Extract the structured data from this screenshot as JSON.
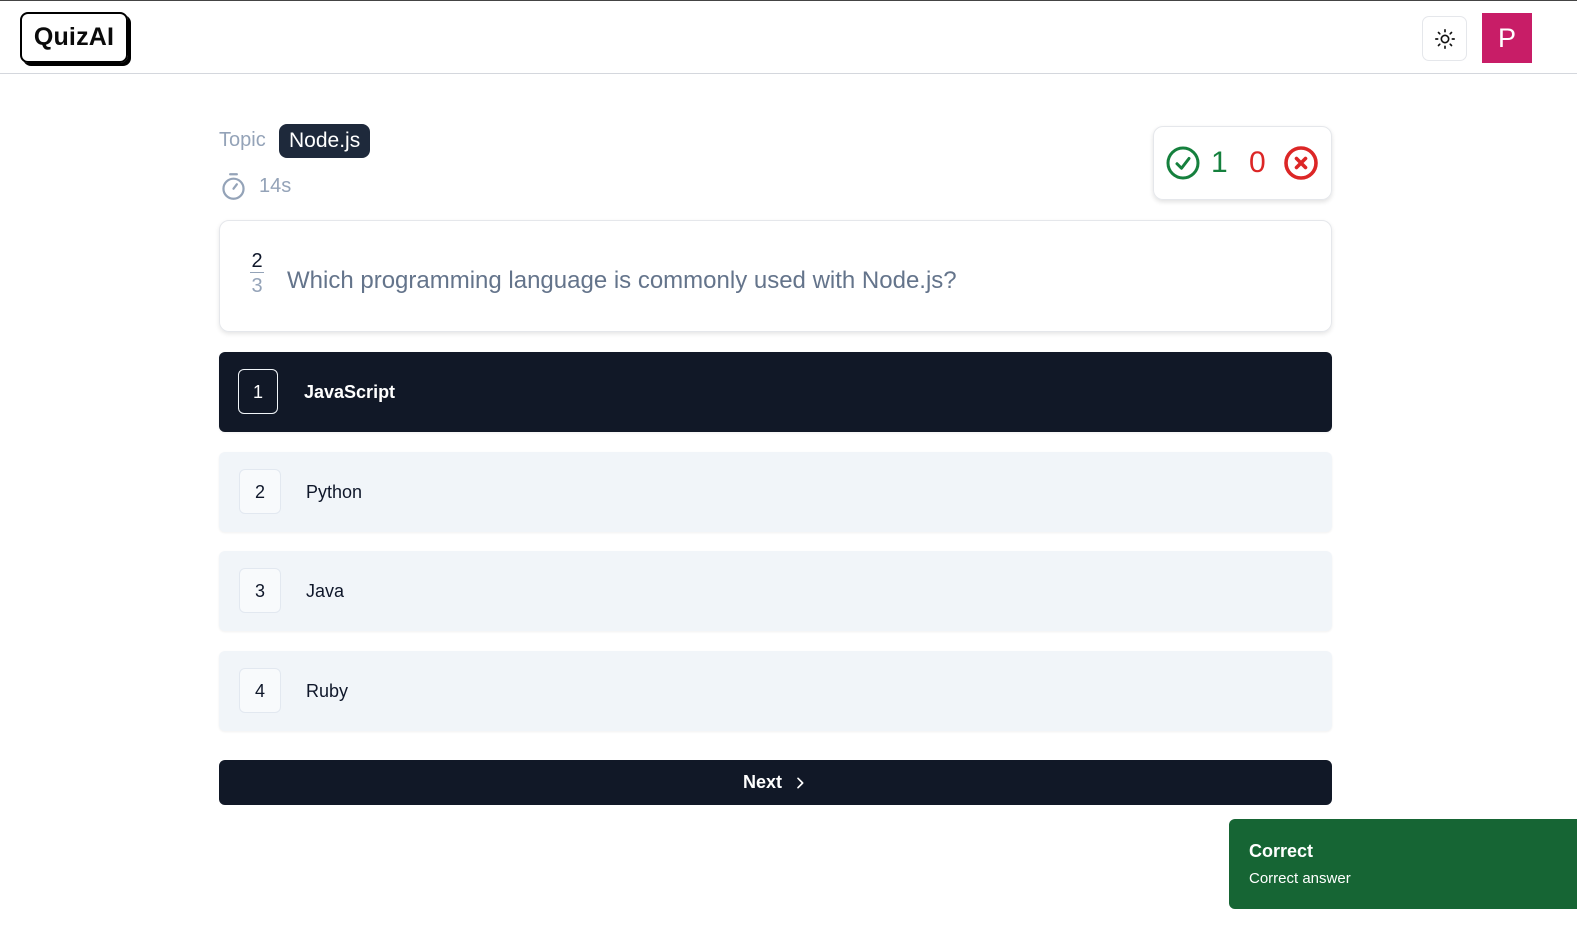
{
  "header": {
    "logo": "QuizAI",
    "theme_toggle_icon": "sun-icon",
    "avatar_initial": "P"
  },
  "quiz": {
    "topic_label": "Topic",
    "topic": "Node.js",
    "timer": "14s",
    "score": {
      "correct": "1",
      "wrong": "0"
    },
    "question_number": "2",
    "question_total": "3",
    "question": "Which programming language is commonly used with Node.js?",
    "options": [
      {
        "number": "1",
        "label": "JavaScript",
        "selected": true
      },
      {
        "number": "2",
        "label": "Python",
        "selected": false
      },
      {
        "number": "3",
        "label": "Java",
        "selected": false
      },
      {
        "number": "4",
        "label": "Ruby",
        "selected": false
      }
    ],
    "next_label": "Next"
  },
  "toast": {
    "title": "Correct",
    "description": "Correct answer"
  },
  "colors": {
    "correct": "#15803d",
    "wrong": "#dc2626",
    "primary": "#111827",
    "avatar": "#c81d67",
    "toast": "#166534"
  }
}
